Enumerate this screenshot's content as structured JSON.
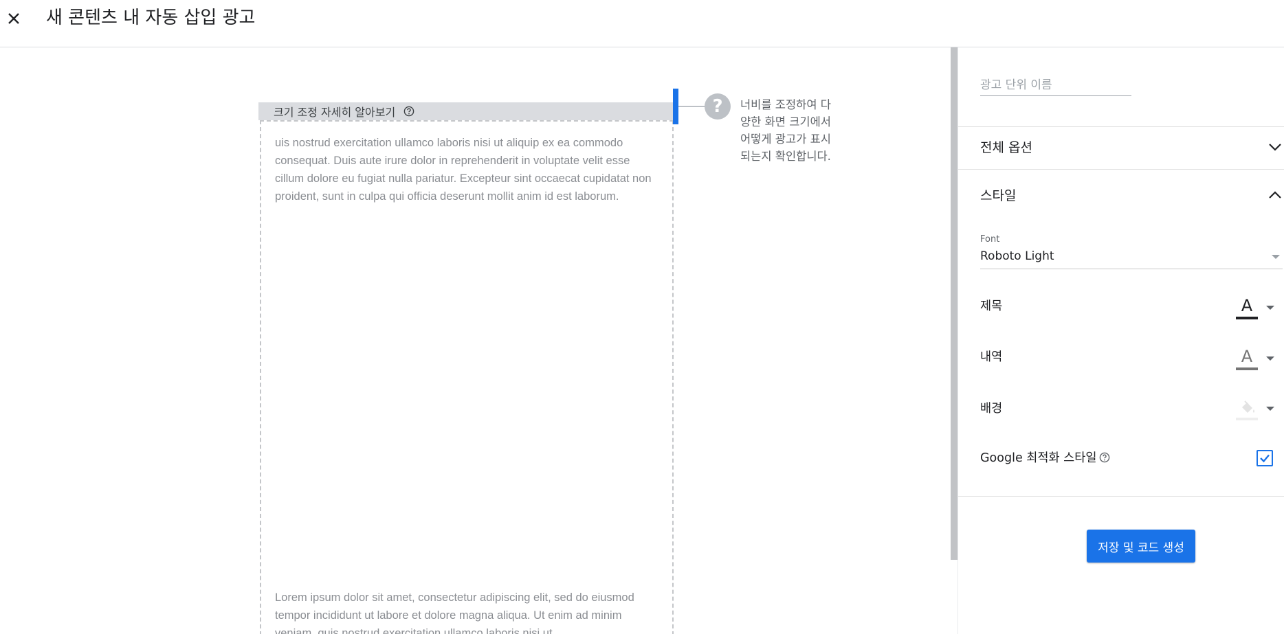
{
  "header": {
    "title": "새 콘텐츠 내 자동 삽입 광고",
    "close_icon": "close-icon"
  },
  "preview": {
    "resize_label": "크기 조정 자세히 알아보기",
    "lorem_top": "uis nostrud exercitation ullamco laboris nisi ut aliquip ex ea commodo consequat. Duis aute irure dolor in reprehenderit in voluptate velit esse cillum dolore eu fugiat nulla pariatur. Excepteur sint occaecat cupidatat non proident, sunt in culpa qui officia deserunt mollit anim id est laborum.",
    "lorem_bottom": "Lorem ipsum dolor sit amet, consectetur adipiscing elit, sed do eiusmod tempor incididunt ut labore et dolore magna aliqua. Ut enim ad minim veniam, quis nostrud exercitation ullamco laboris nisi ut",
    "tip_icon": "?",
    "tip_text": "너비를 조정하여 다양한 화면 크기에서 어떻게 광고가 표시되는지 확인합니다."
  },
  "sidebar": {
    "name_placeholder": "광고 단위 이름",
    "name_value": "",
    "sections": {
      "global_options": "전체 옵션",
      "style": "스타일"
    },
    "font": {
      "label": "Font",
      "value": "Roboto Light"
    },
    "rows": {
      "title_label": "제목",
      "description_label": "내역",
      "background_label": "배경",
      "google_optimized_label": "Google 최적화 스타일"
    },
    "colors": {
      "title_color": "#202124",
      "description_color": "#757575",
      "background_color": "#eeeeee",
      "accent": "#1a73e8"
    },
    "google_optimized_checked": true,
    "save_button": "저장 및 코드 생성"
  }
}
